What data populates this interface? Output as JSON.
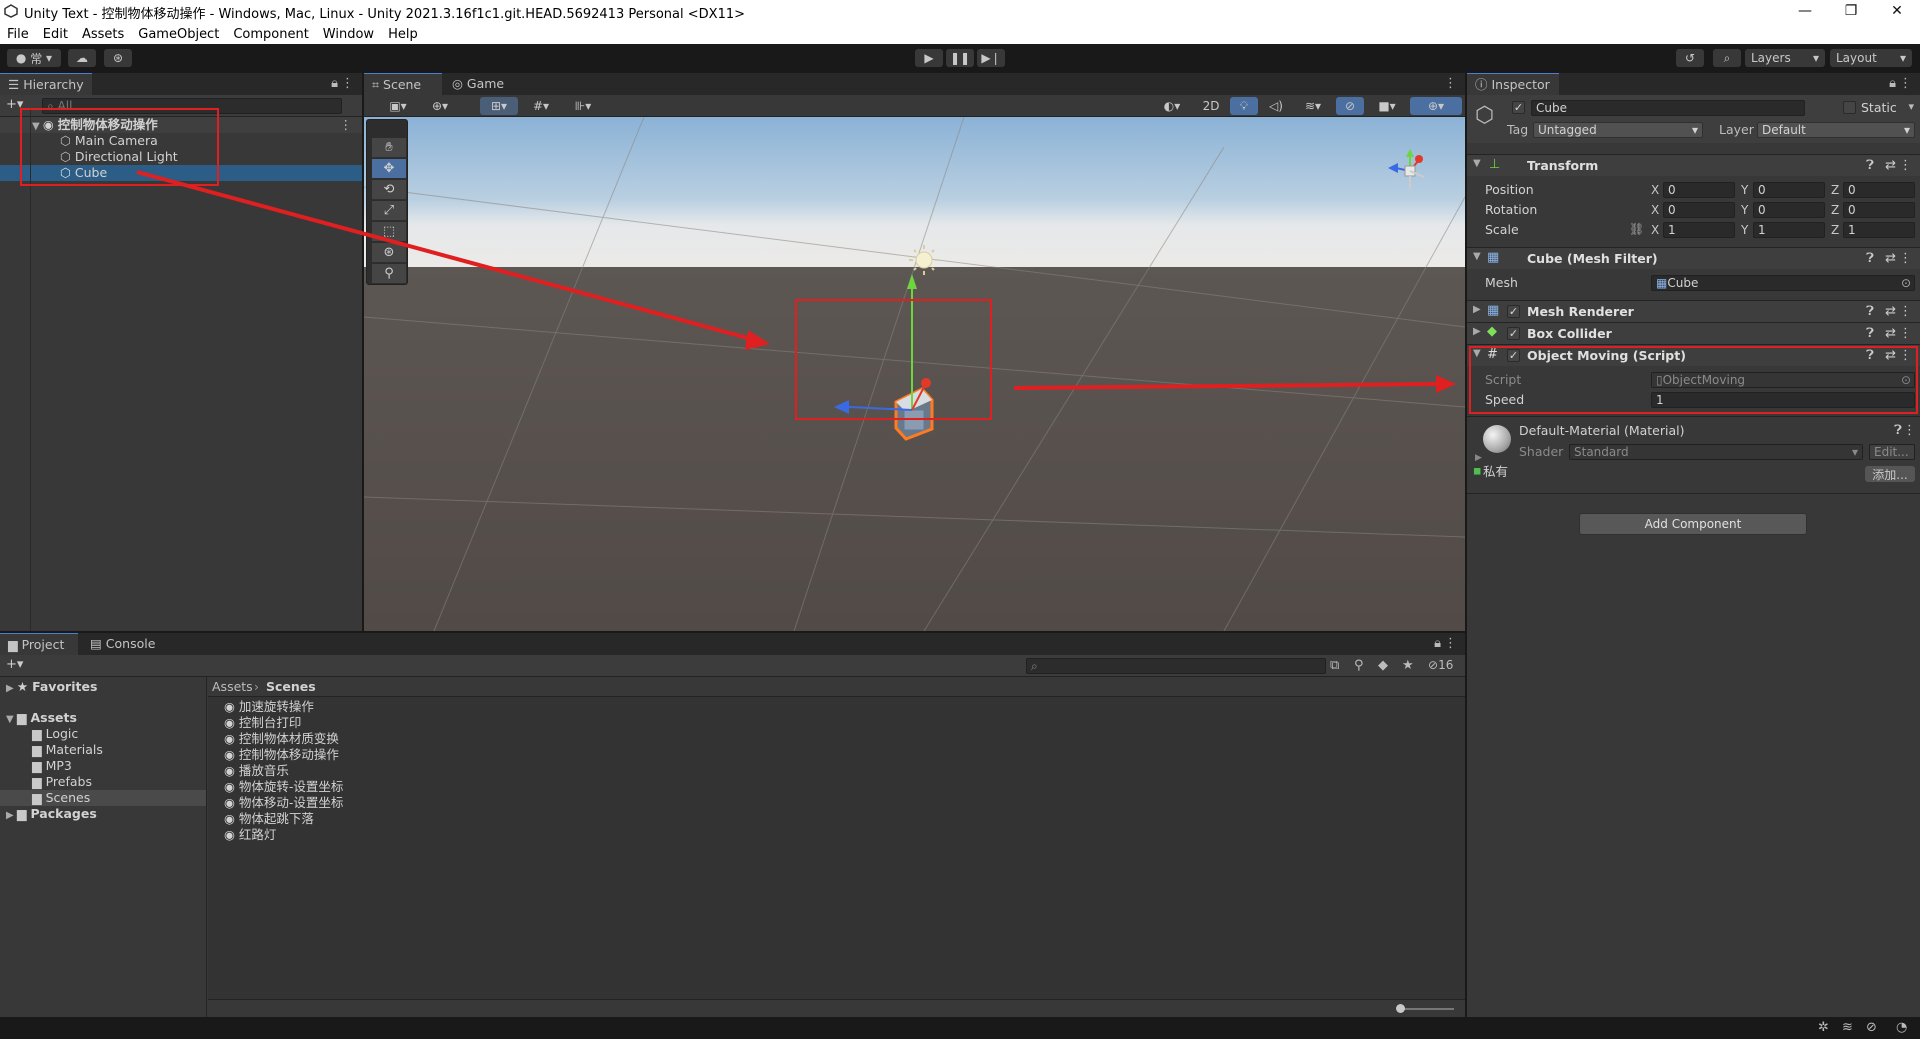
{
  "window": {
    "title": "Unity Text - 控制物体移动操作 - Windows, Mac, Linux - Unity 2021.3.16f1c1.git.HEAD.5692413 Personal <DX11>",
    "controls": [
      "—",
      "❐",
      "✕"
    ]
  },
  "menu": [
    "File",
    "Edit",
    "Assets",
    "GameObject",
    "Component",
    "Window",
    "Help"
  ],
  "toolbar": {
    "account_label": "常",
    "layers_label": "Layers",
    "layout_label": "Layout"
  },
  "hierarchy": {
    "tab_label": "Hierarchy",
    "search_placeholder": "All",
    "scene_name": "控制物体移动操作",
    "items": [
      {
        "label": "Main Camera",
        "icon": "gameobject-icon"
      },
      {
        "label": "Directional Light",
        "icon": "gameobject-icon"
      },
      {
        "label": "Cube",
        "icon": "gameobject-icon",
        "selected": true
      }
    ]
  },
  "scene_view": {
    "tabs": [
      "Scene",
      "Game"
    ],
    "mode_2d": "2D"
  },
  "inspector": {
    "tab_label": "Inspector",
    "object_name": "Cube",
    "static_label": "Static",
    "tag_label": "Tag",
    "tag_value": "Untagged",
    "layer_label": "Layer",
    "layer_value": "Default",
    "transform": {
      "title": "Transform",
      "position_label": "Position",
      "rotation_label": "Rotation",
      "scale_label": "Scale",
      "position": {
        "x": "0",
        "y": "0",
        "z": "0"
      },
      "rotation": {
        "x": "0",
        "y": "0",
        "z": "0"
      },
      "scale": {
        "x": "1",
        "y": "1",
        "z": "1"
      }
    },
    "mesh_filter": {
      "title": "Cube (Mesh Filter)",
      "mesh_label": "Mesh",
      "mesh_value": "Cube"
    },
    "mesh_renderer": {
      "title": "Mesh Renderer"
    },
    "box_collider": {
      "title": "Box Collider"
    },
    "script": {
      "title": "Object Moving (Script)",
      "script_label": "Script",
      "script_value": "ObjectMoving",
      "speed_label": "Speed",
      "speed_value": "1"
    },
    "material": {
      "title": "Default-Material (Material)",
      "shader_label": "Shader",
      "shader_value": "Standard",
      "edit_label": "Edit...",
      "private_label": "私有",
      "add_label": "添加..."
    },
    "add_component_label": "Add Component"
  },
  "project": {
    "tabs": [
      "Project",
      "Console"
    ],
    "hidden_count": "16",
    "favorites_label": "Favorites",
    "assets_label": "Assets",
    "asset_folders": [
      "Logic",
      "Materials",
      "MP3",
      "Prefabs",
      "Scenes"
    ],
    "packages_label": "Packages",
    "breadcrumb": [
      "Assets",
      "Scenes"
    ],
    "scenes": [
      "加速旋转操作",
      "控制台打印",
      "控制物体材质变换",
      "控制物体移动操作",
      "播放音乐",
      "物体旋转-设置坐标",
      "物体移动-设置坐标",
      "物体起跳下落",
      "红路灯"
    ]
  },
  "colors": {
    "annotation_red": "#e02020",
    "selection_blue": "#2c5d87",
    "gizmo_y": "#6cd63c",
    "gizmo_x": "#e23a2a",
    "gizmo_z": "#3a6ae2"
  }
}
